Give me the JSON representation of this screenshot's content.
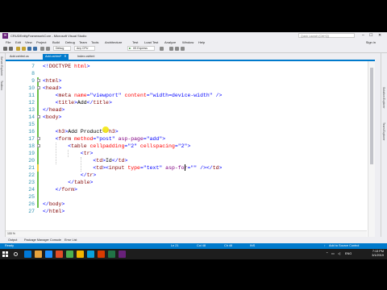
{
  "window": {
    "title": "CRUDEntityFrameworkCore - Microsoft Visual Studio",
    "quick_launch_placeholder": "Quick Launch (Ctrl+Q)",
    "sign_in": "Sign in"
  },
  "menu": [
    "File",
    "Edit",
    "View",
    "Project",
    "Build",
    "Debug",
    "Team",
    "Tools",
    "Architecture",
    "Test",
    "Load Test",
    "Analyze",
    "Window",
    "Help"
  ],
  "toolbar": {
    "config": "Debug",
    "platform": "Any CPU",
    "run_target": "IIS Express"
  },
  "left_dock": [
    "Server Explorer",
    "Toolbox"
  ],
  "right_dock": [
    "Solution Explorer",
    "Team Explorer"
  ],
  "tabs": [
    {
      "label": "Add.cshtml.cs",
      "active": false
    },
    {
      "label": "Add.cshtml*",
      "active": true
    },
    {
      "label": "Index.cshtml",
      "active": false
    }
  ],
  "editor": {
    "lines": [
      {
        "n": "7",
        "indent": 0,
        "tokens": [
          [
            "<!",
            "#0000ff"
          ],
          [
            "DOCTYPE",
            "#800000"
          ],
          [
            " html",
            "#ff0000"
          ],
          [
            ">",
            "#0000ff"
          ]
        ]
      },
      {
        "n": "8",
        "indent": 0,
        "tokens": []
      },
      {
        "n": "9",
        "indent": 0,
        "tokens": [
          [
            "<",
            "#0000ff"
          ],
          [
            "html",
            "#800000"
          ],
          [
            ">",
            "#0000ff"
          ]
        ]
      },
      {
        "n": "10",
        "indent": 0,
        "tokens": [
          [
            "<",
            "#0000ff"
          ],
          [
            "head",
            "#800000"
          ],
          [
            ">",
            "#0000ff"
          ]
        ]
      },
      {
        "n": "11",
        "indent": 2,
        "tokens": [
          [
            "<",
            "#0000ff"
          ],
          [
            "meta",
            "#800000"
          ],
          [
            " name",
            "#ff0000"
          ],
          [
            "=",
            "#0000ff"
          ],
          [
            "\"viewport\"",
            "#0000ff"
          ],
          [
            " content",
            "#ff0000"
          ],
          [
            "=",
            "#0000ff"
          ],
          [
            "\"width=device-width\"",
            "#0000ff"
          ],
          [
            " />",
            "#0000ff"
          ]
        ]
      },
      {
        "n": "12",
        "indent": 2,
        "tokens": [
          [
            "<",
            "#0000ff"
          ],
          [
            "title",
            "#800000"
          ],
          [
            ">",
            "#0000ff"
          ],
          [
            "Add",
            "#000000"
          ],
          [
            "</",
            "#0000ff"
          ],
          [
            "title",
            "#800000"
          ],
          [
            ">",
            "#0000ff"
          ]
        ]
      },
      {
        "n": "13",
        "indent": 0,
        "tokens": [
          [
            "</",
            "#0000ff"
          ],
          [
            "head",
            "#800000"
          ],
          [
            ">",
            "#0000ff"
          ]
        ]
      },
      {
        "n": "14",
        "indent": 0,
        "tokens": [
          [
            "<",
            "#0000ff"
          ],
          [
            "body",
            "#800000"
          ],
          [
            ">",
            "#0000ff"
          ]
        ]
      },
      {
        "n": "15",
        "indent": 0,
        "tokens": []
      },
      {
        "n": "16",
        "indent": 2,
        "tokens": [
          [
            "<",
            "#0000ff"
          ],
          [
            "h3",
            "#800000"
          ],
          [
            ">",
            "#0000ff"
          ],
          [
            "Add Product",
            "#000000"
          ],
          [
            "</",
            "#0000ff"
          ],
          [
            "h3",
            "#800000"
          ],
          [
            ">",
            "#0000ff"
          ]
        ]
      },
      {
        "n": "17",
        "indent": 2,
        "tokens": [
          [
            "<",
            "#0000ff"
          ],
          [
            "form",
            "#800000"
          ],
          [
            " method",
            "#ff0000"
          ],
          [
            "=",
            "#0000ff"
          ],
          [
            "\"post\"",
            "#0000ff"
          ],
          [
            " asp-page",
            "#800080"
          ],
          [
            "=",
            "#0000ff"
          ],
          [
            "\"add\"",
            "#0000ff"
          ],
          [
            ">",
            "#0000ff"
          ]
        ]
      },
      {
        "n": "18",
        "indent": 4,
        "tokens": [
          [
            "<",
            "#0000ff"
          ],
          [
            "table",
            "#800000"
          ],
          [
            " cellpadding",
            "#ff0000"
          ],
          [
            "=",
            "#0000ff"
          ],
          [
            "\"2\"",
            "#0000ff"
          ],
          [
            " cellspacing",
            "#ff0000"
          ],
          [
            "=",
            "#0000ff"
          ],
          [
            "\"2\"",
            "#0000ff"
          ],
          [
            ">",
            "#0000ff"
          ]
        ]
      },
      {
        "n": "19",
        "indent": 6,
        "tokens": [
          [
            "<",
            "#0000ff"
          ],
          [
            "tr",
            "#800000"
          ],
          [
            ">",
            "#0000ff"
          ]
        ]
      },
      {
        "n": "20",
        "indent": 8,
        "tokens": [
          [
            "<",
            "#0000ff"
          ],
          [
            "td",
            "#800000"
          ],
          [
            ">",
            "#0000ff"
          ],
          [
            "Id",
            "#000000"
          ],
          [
            "</",
            "#0000ff"
          ],
          [
            "td",
            "#800000"
          ],
          [
            ">",
            "#0000ff"
          ]
        ]
      },
      {
        "n": "21",
        "indent": 8,
        "tokens": [
          [
            "<",
            "#0000ff"
          ],
          [
            "td",
            "#800000"
          ],
          [
            ">",
            "#0000ff"
          ],
          [
            "<",
            "#0000ff"
          ],
          [
            "input",
            "#800000"
          ],
          [
            " type",
            "#ff0000"
          ],
          [
            "=",
            "#0000ff"
          ],
          [
            "\"text\"",
            "#0000ff"
          ],
          [
            " asp-for",
            "#800080"
          ],
          [
            "=",
            "#0000ff"
          ],
          [
            "\"\"",
            "#0000ff"
          ],
          [
            " />",
            "#0000ff"
          ],
          [
            "</",
            "#0000ff"
          ],
          [
            "td",
            "#800000"
          ],
          [
            ">",
            "#0000ff"
          ]
        ]
      },
      {
        "n": "22",
        "indent": 6,
        "tokens": [
          [
            "</",
            "#0000ff"
          ],
          [
            "tr",
            "#800000"
          ],
          [
            ">",
            "#0000ff"
          ]
        ]
      },
      {
        "n": "23",
        "indent": 4,
        "tokens": [
          [
            "</",
            "#0000ff"
          ],
          [
            "table",
            "#800000"
          ],
          [
            ">",
            "#0000ff"
          ]
        ]
      },
      {
        "n": "24",
        "indent": 2,
        "tokens": [
          [
            "</",
            "#0000ff"
          ],
          [
            "form",
            "#800000"
          ],
          [
            ">",
            "#0000ff"
          ]
        ]
      },
      {
        "n": "25",
        "indent": 0,
        "tokens": []
      },
      {
        "n": "26",
        "indent": 0,
        "tokens": [
          [
            "</",
            "#0000ff"
          ],
          [
            "body",
            "#800000"
          ],
          [
            ">",
            "#0000ff"
          ]
        ]
      },
      {
        "n": "27",
        "indent": 0,
        "tokens": [
          [
            "</",
            "#0000ff"
          ],
          [
            "html",
            "#800000"
          ],
          [
            ">",
            "#0000ff"
          ]
        ]
      }
    ],
    "zoom": "100 %"
  },
  "bottom_tabs": [
    "Output",
    "Package Manager Console",
    "Error List"
  ],
  "status": {
    "left": "Ready",
    "ln": "Ln 21",
    "col": "Col 48",
    "ch": "Ch 48",
    "ins": "INS",
    "source_control": "Add to Source Control"
  },
  "taskbar": {
    "lang": "ENG",
    "time": "7:13 PM",
    "date": "3/1/2019",
    "icon_colors": [
      "#0078d7",
      "#e8a33d",
      "#1e90ff",
      "#e34c26",
      "#4caf50",
      "#f4b400",
      "#0aa1dd",
      "#d83b01",
      "#217346",
      "#68217a"
    ]
  },
  "accent": "#007acc"
}
